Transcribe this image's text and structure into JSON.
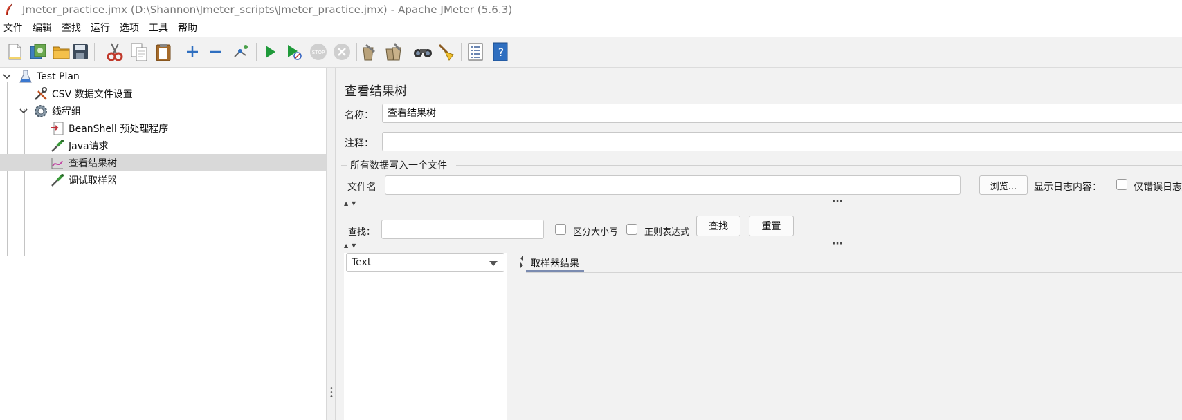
{
  "window": {
    "title": "Jmeter_practice.jmx (D:\\Shannon\\Jmeter_scripts\\Jmeter_practice.jmx) - Apache JMeter (5.6.3)"
  },
  "menu": [
    "文件",
    "编辑",
    "查找",
    "运行",
    "选项",
    "工具",
    "帮助"
  ],
  "toolbar": [
    "new-file-icon",
    "templates-icon",
    "open-icon",
    "save-icon",
    "cut-icon",
    "copy-icon",
    "paste-icon",
    "expand-icon",
    "collapse-icon",
    "toggle-icon",
    "start-icon",
    "start-no-pause-icon",
    "stop-icon",
    "shutdown-icon",
    "clear-icon",
    "clear-all-icon",
    "search-icon",
    "reset-search-icon",
    "function-helper-icon",
    "help-icon"
  ],
  "tree": [
    {
      "label": "Test Plan",
      "icon": "flask-icon"
    },
    {
      "label": "CSV 数据文件设置",
      "icon": "tools-icon"
    },
    {
      "label": "线程组",
      "icon": "gear-icon"
    },
    {
      "label": "BeanShell 预处理程序",
      "icon": "preprocessor-icon"
    },
    {
      "label": "Java请求",
      "icon": "sampler-icon"
    },
    {
      "label": "查看结果树",
      "icon": "listener-icon",
      "selected": true
    },
    {
      "label": "调试取样器",
      "icon": "sampler-icon"
    }
  ],
  "panel": {
    "heading": "查看结果树",
    "name_label": "名称：",
    "name_value": "查看结果树",
    "comment_label": "注释：",
    "comment_value": "",
    "group_title": "所有数据写入一个文件",
    "filename_label": "文件名",
    "filename_value": "",
    "browse_label": "浏览...",
    "log_label": "显示日志内容：",
    "errors_only_label": "仅错误日志",
    "search_label": "查找：",
    "search_value": "",
    "case_label": "区分大小写",
    "regex_label": "正则表达式",
    "find_button": "查找",
    "reset_button": "重置",
    "renderer_value": "Text",
    "result_tab": "取样器结果"
  }
}
